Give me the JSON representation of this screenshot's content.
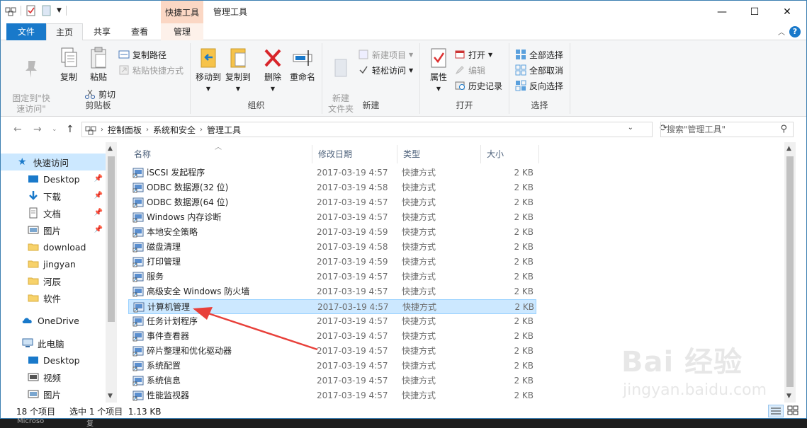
{
  "titlebar": {
    "context_tab": "快捷工具",
    "title": "管理工具",
    "minimize": "—",
    "maximize": "☐",
    "close": "✕"
  },
  "tabs": [
    {
      "label": "文件"
    },
    {
      "label": "主页"
    },
    {
      "label": "共享"
    },
    {
      "label": "查看"
    },
    {
      "label": "管理"
    }
  ],
  "ribbon": {
    "clipboard": {
      "label": "剪贴板",
      "pin": "固定到\"快\n速访问\"",
      "copy": "复制",
      "paste": "粘贴",
      "copy_path": "复制路径",
      "paste_shortcut": "粘贴快捷方式",
      "cut": "剪切"
    },
    "organize": {
      "label": "组织",
      "move_to": "移动到",
      "copy_to": "复制到",
      "delete": "删除",
      "rename": "重命名"
    },
    "new": {
      "label": "新建",
      "new_folder": "新建\n文件夹",
      "new_item": "新建项目",
      "easy_access": "轻松访问"
    },
    "open": {
      "label": "打开",
      "properties": "属性",
      "open": "打开",
      "edit": "编辑",
      "history": "历史记录"
    },
    "select": {
      "label": "选择",
      "select_all": "全部选择",
      "select_none": "全部取消",
      "invert": "反向选择"
    }
  },
  "address": {
    "crumbs": [
      "控制面板",
      "系统和安全",
      "管理工具"
    ],
    "search_placeholder": "搜索\"管理工具\""
  },
  "nav": {
    "quick_access": "快速访问",
    "items": [
      {
        "label": "Desktop",
        "pinned": true
      },
      {
        "label": "下载",
        "pinned": true
      },
      {
        "label": "文档",
        "pinned": true
      },
      {
        "label": "图片",
        "pinned": true
      },
      {
        "label": "download",
        "pinned": false
      },
      {
        "label": "jingyan",
        "pinned": false
      },
      {
        "label": "河辰",
        "pinned": false
      },
      {
        "label": "软件",
        "pinned": false
      }
    ],
    "onedrive": "OneDrive",
    "this_pc": "此电脑",
    "pc_items": [
      {
        "label": "Desktop"
      },
      {
        "label": "视频"
      },
      {
        "label": "图片"
      }
    ]
  },
  "columns": {
    "name": "名称",
    "date": "修改日期",
    "type": "类型",
    "size": "大小"
  },
  "files": [
    {
      "name": "iSCSI 发起程序",
      "date": "2017-03-19 4:57",
      "type": "快捷方式",
      "size": "2 KB"
    },
    {
      "name": "ODBC 数据源(32 位)",
      "date": "2017-03-19 4:58",
      "type": "快捷方式",
      "size": "2 KB"
    },
    {
      "name": "ODBC 数据源(64 位)",
      "date": "2017-03-19 4:57",
      "type": "快捷方式",
      "size": "2 KB"
    },
    {
      "name": "Windows 内存诊断",
      "date": "2017-03-19 4:57",
      "type": "快捷方式",
      "size": "2 KB"
    },
    {
      "name": "本地安全策略",
      "date": "2017-03-19 4:59",
      "type": "快捷方式",
      "size": "2 KB"
    },
    {
      "name": "磁盘清理",
      "date": "2017-03-19 4:58",
      "type": "快捷方式",
      "size": "2 KB"
    },
    {
      "name": "打印管理",
      "date": "2017-03-19 4:59",
      "type": "快捷方式",
      "size": "2 KB"
    },
    {
      "name": "服务",
      "date": "2017-03-19 4:57",
      "type": "快捷方式",
      "size": "2 KB"
    },
    {
      "name": "高级安全 Windows 防火墙",
      "date": "2017-03-19 4:57",
      "type": "快捷方式",
      "size": "2 KB"
    },
    {
      "name": "计算机管理",
      "date": "2017-03-19 4:57",
      "type": "快捷方式",
      "size": "2 KB",
      "selected": true
    },
    {
      "name": "任务计划程序",
      "date": "2017-03-19 4:57",
      "type": "快捷方式",
      "size": "2 KB"
    },
    {
      "name": "事件查看器",
      "date": "2017-03-19 4:57",
      "type": "快捷方式",
      "size": "2 KB"
    },
    {
      "name": "碎片整理和优化驱动器",
      "date": "2017-03-19 4:57",
      "type": "快捷方式",
      "size": "2 KB"
    },
    {
      "name": "系统配置",
      "date": "2017-03-19 4:57",
      "type": "快捷方式",
      "size": "2 KB"
    },
    {
      "name": "系统信息",
      "date": "2017-03-19 4:57",
      "type": "快捷方式",
      "size": "2 KB"
    },
    {
      "name": "性能监视器",
      "date": "2017-03-19 4:57",
      "type": "快捷方式",
      "size": "2 KB"
    }
  ],
  "status": {
    "count": "18 个项目",
    "selection": "选中 1 个项目  1.13 KB"
  },
  "watermark": {
    "brand": "Bai 经验",
    "url": "jingyan.baidu.com"
  },
  "taskbar": {
    "left": "Microso",
    "right": "复"
  },
  "colors": {
    "accent": "#1979ca",
    "selection": "#cce8ff",
    "context_tab": "#fbd7c4",
    "arrow": "#e8403a"
  }
}
